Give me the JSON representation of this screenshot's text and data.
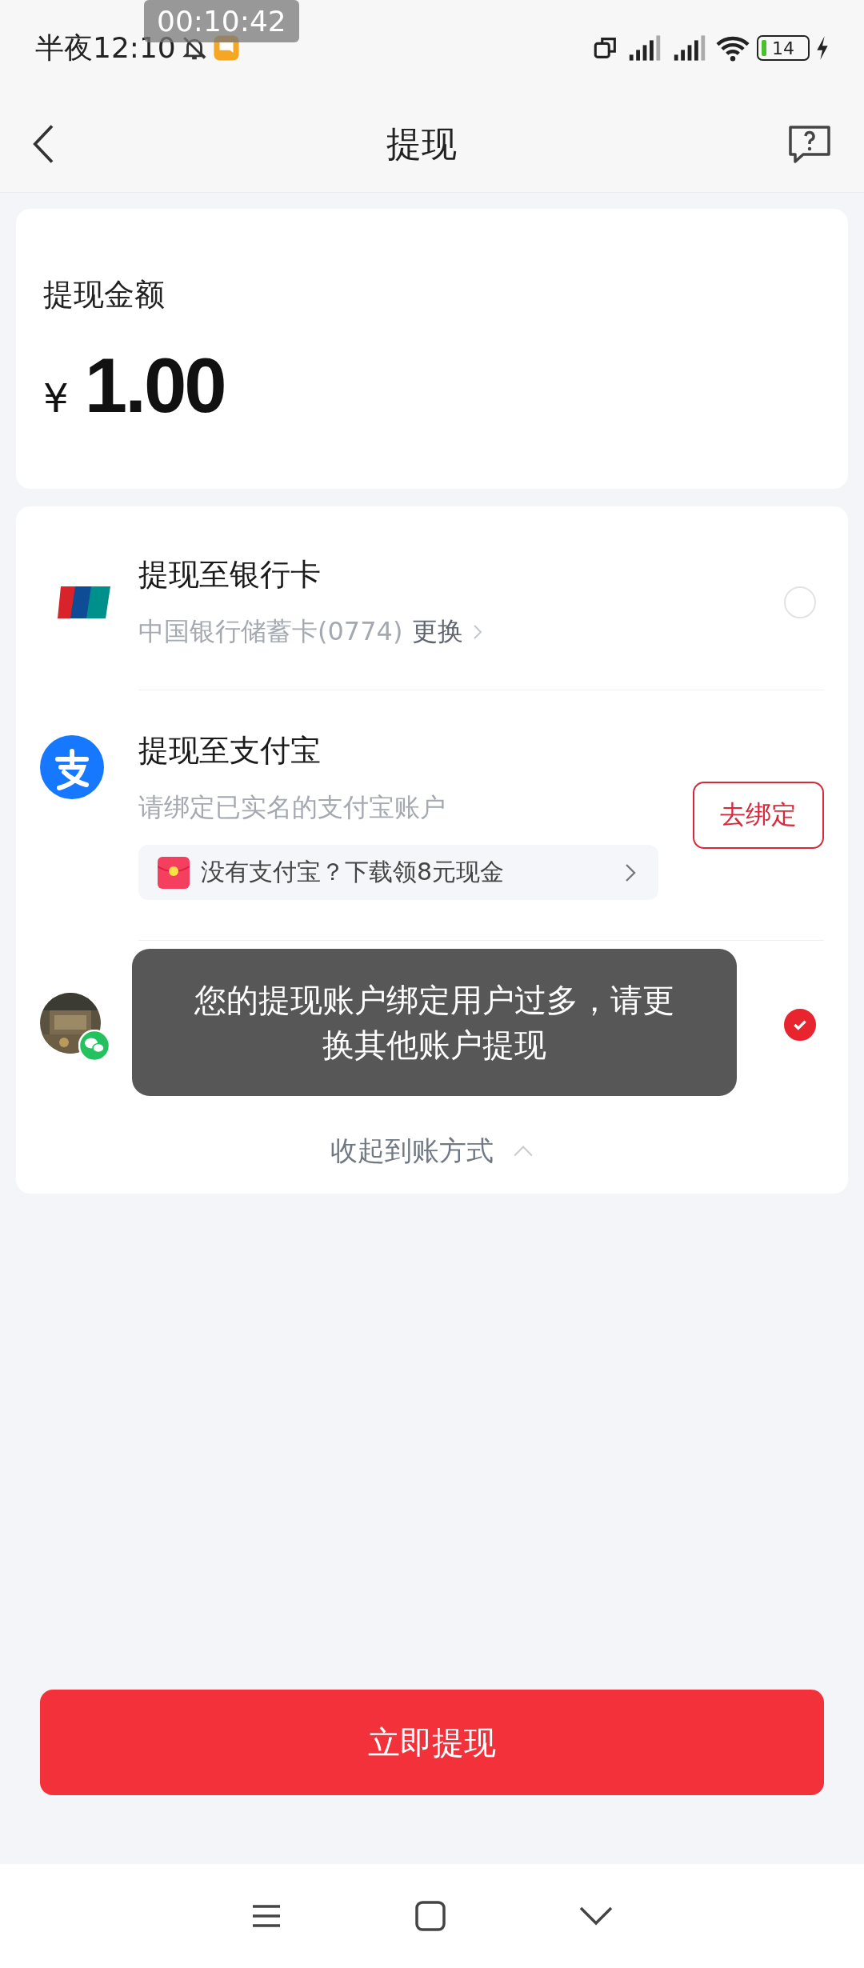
{
  "status_bar": {
    "time": "半夜12:10",
    "recording_timer": "00:10:42",
    "battery": "14"
  },
  "header": {
    "title": "提现"
  },
  "amount": {
    "label": "提现金额",
    "currency": "¥",
    "value": "1.00"
  },
  "methods": [
    {
      "kind": "bank",
      "title": "提现至银行卡",
      "account": "中国银行储蓄卡(0774)",
      "action": "更换",
      "selected": false
    },
    {
      "kind": "alipay",
      "title": "提现至支付宝",
      "hint": "请绑定已实名的支付宝账户",
      "bind_button": "去绑定",
      "promo": "没有支付宝？下载领8元现金"
    },
    {
      "kind": "wechat",
      "selected": true
    }
  ],
  "collapse": "收起到账方式",
  "toast": "您的提现账户绑定用户过多，请更换其他账户提现",
  "submit": "立即提现"
}
